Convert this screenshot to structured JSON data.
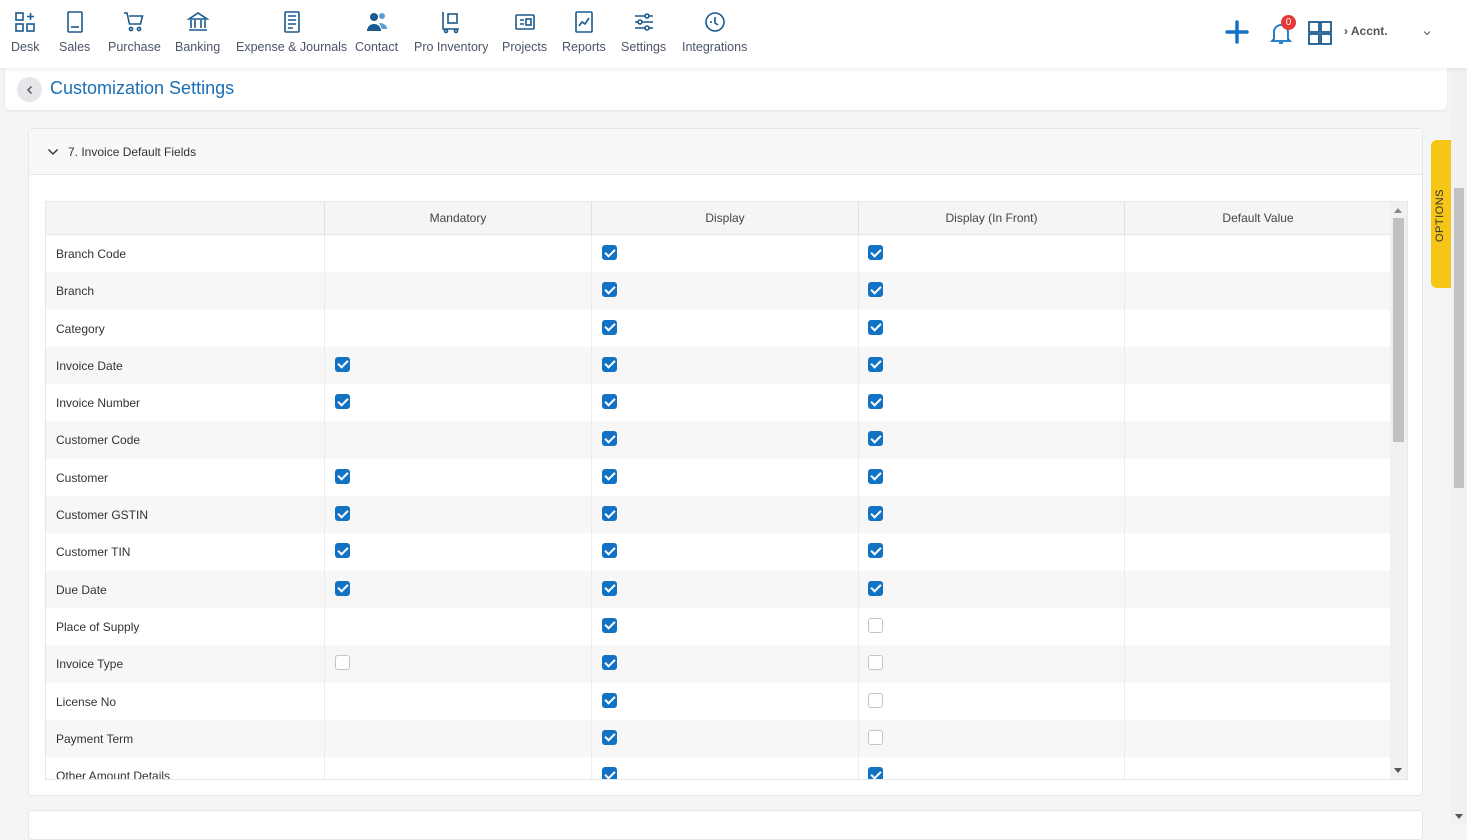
{
  "nav": [
    {
      "label": "Desk",
      "icon": "desk-icon"
    },
    {
      "label": "Sales",
      "icon": "sales-icon"
    },
    {
      "label": "Purchase",
      "icon": "cart-icon"
    },
    {
      "label": "Banking",
      "icon": "bank-icon"
    },
    {
      "label": "Expense & Journals",
      "icon": "journal-icon"
    },
    {
      "label": "Contact",
      "icon": "contacts-icon"
    },
    {
      "label": "Pro Inventory",
      "icon": "inventory-icon"
    },
    {
      "label": "Projects",
      "icon": "projects-icon"
    },
    {
      "label": "Reports",
      "icon": "reports-icon"
    },
    {
      "label": "Settings",
      "icon": "sliders-icon"
    },
    {
      "label": "Integrations",
      "icon": "integrations-icon"
    }
  ],
  "header": {
    "notification_count": "0",
    "account_name": "› Accnt."
  },
  "page": {
    "title": "Customization Settings",
    "section_title": "7. Invoice Default Fields",
    "options_label": "OPTIONS"
  },
  "table": {
    "columns": [
      "Mandatory",
      "Display",
      "Display (In Front)",
      "Default Value"
    ],
    "rows": [
      {
        "field": "Branch Code",
        "mandatory": null,
        "display": true,
        "display_front": true
      },
      {
        "field": "Branch",
        "mandatory": null,
        "display": true,
        "display_front": true
      },
      {
        "field": "Category",
        "mandatory": null,
        "display": true,
        "display_front": true
      },
      {
        "field": "Invoice Date",
        "mandatory": true,
        "display": true,
        "display_front": true
      },
      {
        "field": "Invoice Number",
        "mandatory": true,
        "display": true,
        "display_front": true
      },
      {
        "field": "Customer Code",
        "mandatory": null,
        "display": true,
        "display_front": true
      },
      {
        "field": "Customer",
        "mandatory": true,
        "display": true,
        "display_front": true
      },
      {
        "field": "Customer GSTIN",
        "mandatory": true,
        "display": true,
        "display_front": true
      },
      {
        "field": "Customer TIN",
        "mandatory": true,
        "display": true,
        "display_front": true
      },
      {
        "field": "Due Date",
        "mandatory": true,
        "display": true,
        "display_front": true
      },
      {
        "field": "Place of Supply",
        "mandatory": null,
        "display": true,
        "display_front": false
      },
      {
        "field": "Invoice Type",
        "mandatory": false,
        "display": true,
        "display_front": false
      },
      {
        "field": "License No",
        "mandatory": null,
        "display": true,
        "display_front": false
      },
      {
        "field": "Payment Term",
        "mandatory": null,
        "display": true,
        "display_front": false
      },
      {
        "field": "Other Amount Details",
        "mandatory": null,
        "display": true,
        "display_front": true
      }
    ]
  },
  "colors": {
    "accent": "#1272c4",
    "title": "#1a6fb5",
    "options_tab": "#f5c518",
    "badge": "#e53935"
  }
}
